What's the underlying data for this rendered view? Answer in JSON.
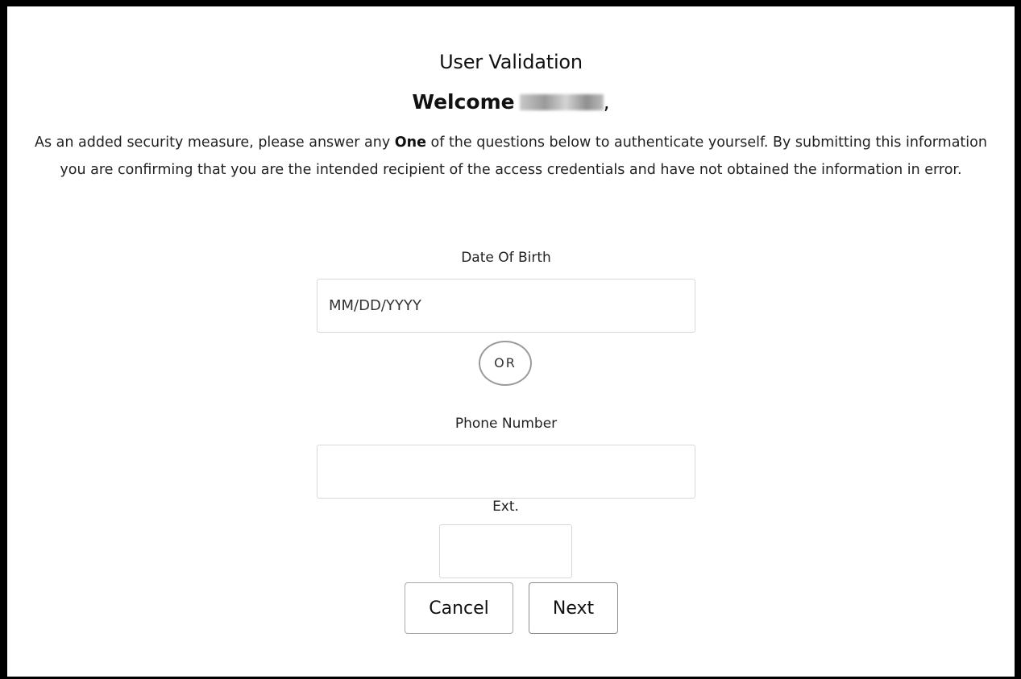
{
  "page": {
    "title": "User Validation",
    "welcome_prefix": "Welcome",
    "welcome_suffix": ",",
    "intro_before": "As an added security measure, please answer any ",
    "intro_emphasis": "One",
    "intro_after": " of the questions below to authenticate yourself. By submitting this information you are confirming that you are the intended recipient of the access credentials and have not obtained the information in error."
  },
  "form": {
    "dob_label": "Date Of Birth",
    "dob_placeholder": "MM/DD/YYYY",
    "dob_value": "",
    "or_label": "OR",
    "phone_label": "Phone Number",
    "phone_value": "",
    "ext_label": "Ext.",
    "ext_value": ""
  },
  "actions": {
    "cancel_label": "Cancel",
    "next_label": "Next"
  }
}
